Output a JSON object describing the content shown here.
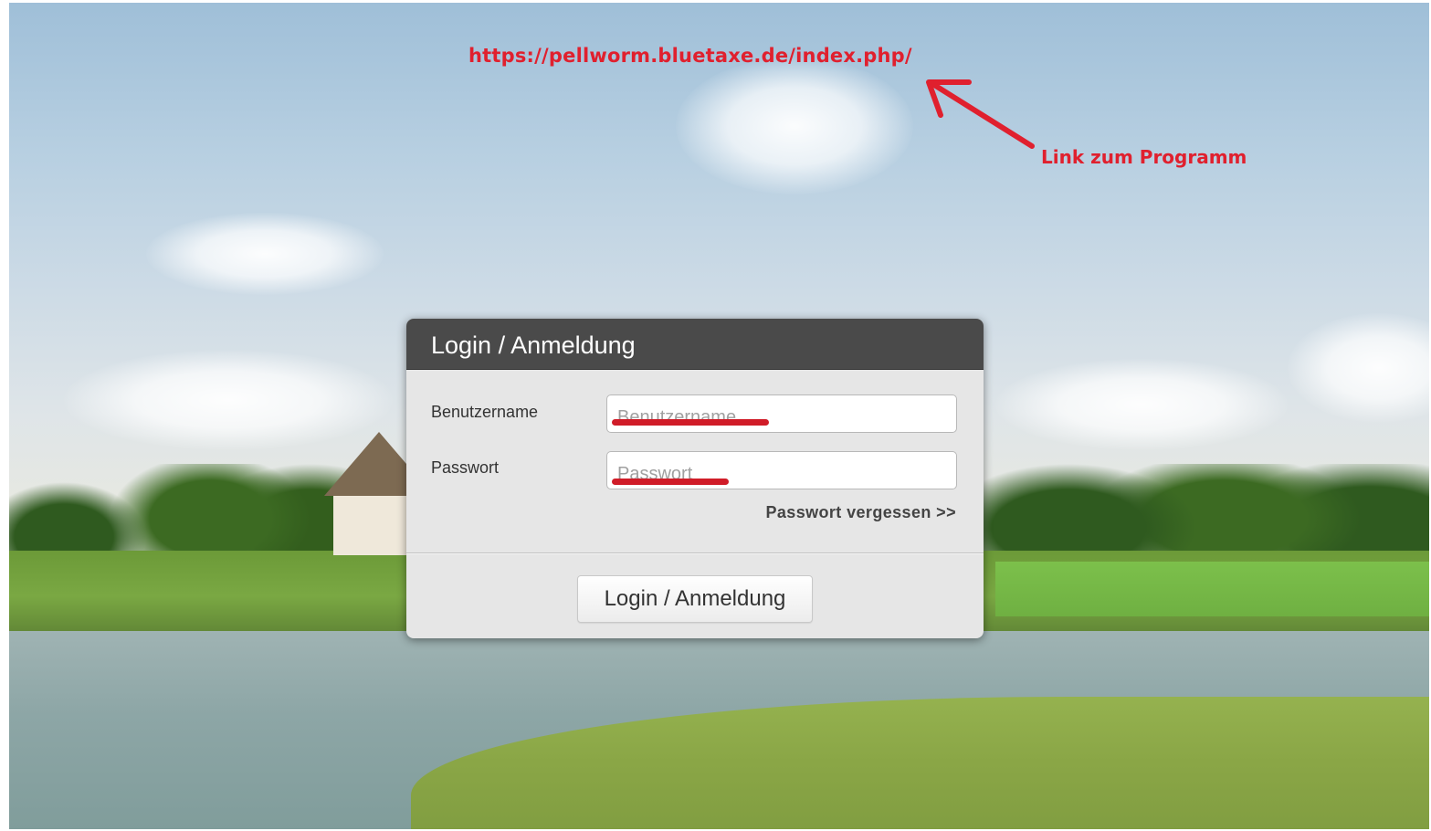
{
  "annotations": {
    "url_text": "https://pellworm.bluetaxe.de/index.php/",
    "hint_text": "Link zum Programm",
    "color": "#e0202e"
  },
  "dialog": {
    "title": "Login / Anmeldung",
    "username_label": "Benutzername",
    "username_placeholder": "Benutzername",
    "password_label": "Passwort",
    "password_placeholder": "Passwort",
    "forgot_link": "Passwort vergessen >>",
    "submit_label": "Login / Anmeldung",
    "header_color": "#4a4a4a",
    "body_color": "#e6e6e6"
  }
}
